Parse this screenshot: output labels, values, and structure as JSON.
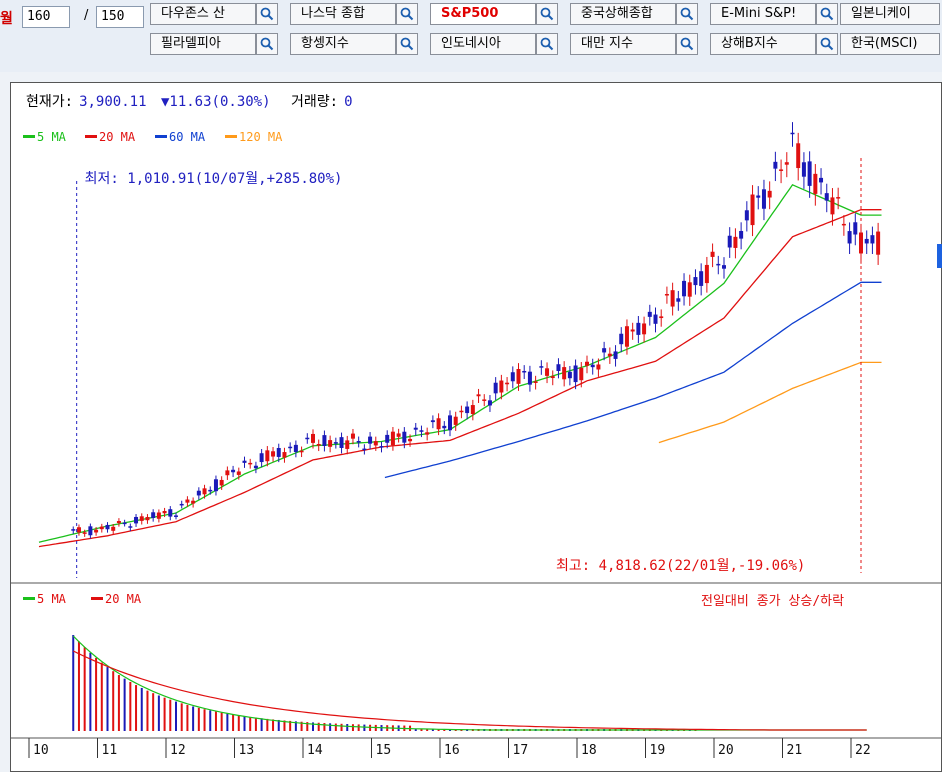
{
  "toolbar": {
    "period_label": "월",
    "count_value": "160",
    "separator": "/",
    "total_value": "150",
    "row1": [
      "다우존스 산",
      "나스닥 종합",
      "S&P500",
      "중국상해종합",
      "E-Mini S&P!",
      "일본니케이"
    ],
    "row2": [
      "필라델피아",
      "항셍지수",
      "인도네시아",
      "대만 지수",
      "상해B지수",
      "한국(MSCI)"
    ],
    "active_index": 2,
    "icon": "search-icon"
  },
  "info": {
    "price_label": "현재가:",
    "price_value": "3,900.11",
    "change_arrow": "▼",
    "change_value": "11.63(0.30%)",
    "volume_label": "거래량:",
    "volume_value": "0"
  },
  "legend_price": [
    {
      "name": "5 MA",
      "color": "#1bc01b"
    },
    {
      "name": "20 MA",
      "color": "#e01010"
    },
    {
      "name": "60 MA",
      "color": "#1040d0"
    },
    {
      "name": "120 MA",
      "color": "#ff9a1a"
    }
  ],
  "legend_volume": [
    {
      "name": "5 MA",
      "color": "#1bc01b"
    },
    {
      "name": "20 MA",
      "color": "#e01010"
    }
  ],
  "annotations": {
    "low_text": "최저: 1,010.91(10/07월,+285.80%)",
    "high_text": "최고: 4,818.62(22/01월,-19.06%)",
    "volume_note": "전일대비 종가 상승/하락"
  },
  "colors": {
    "up": "#e01010",
    "down": "#1a1ab8",
    "text_blue": "#2020c0",
    "annotation_red": "#e01010"
  },
  "chart_data": {
    "type": "line",
    "title": "S&P500",
    "x_tick_labels": [
      "10",
      "11",
      "12",
      "13",
      "14",
      "15",
      "16",
      "17",
      "18",
      "19",
      "20",
      "21",
      "22"
    ],
    "x": [
      2010,
      2011,
      2012,
      2013,
      2014,
      2015,
      2016,
      2017,
      2018,
      2019,
      2020,
      2021,
      2022
    ],
    "series": [
      {
        "name": "Close",
        "values": [
          1180,
          1260,
          1420,
          1840,
          2060,
          2045,
          2240,
          2670,
          2710,
          3230,
          3760,
          4770,
          3900
        ]
      },
      {
        "name": "5 MA",
        "values": [
          1130,
          1280,
          1400,
          1760,
          2020,
          2060,
          2170,
          2570,
          2760,
          3020,
          3520,
          4430,
          4150
        ]
      },
      {
        "name": "20 MA",
        "values": [
          1090,
          1190,
          1320,
          1590,
          1890,
          2010,
          2070,
          2320,
          2620,
          2800,
          3200,
          3950,
          4200
        ]
      },
      {
        "name": "60 MA",
        "values": [
          null,
          null,
          null,
          null,
          null,
          1720,
          1880,
          2060,
          2250,
          2460,
          2700,
          3150,
          3530
        ]
      },
      {
        "name": "120 MA",
        "values": [
          null,
          null,
          null,
          null,
          null,
          null,
          null,
          null,
          null,
          2040,
          2240,
          2550,
          2790
        ]
      }
    ],
    "low_point": {
      "value": 1010.91,
      "date": "10/07"
    },
    "high_point": {
      "value": 4818.62,
      "date": "22/01"
    },
    "volume": {
      "values": [
        0,
        0,
        0,
        0,
        0,
        0,
        0,
        0,
        0,
        0,
        0,
        0,
        0
      ]
    },
    "legend": "top-left",
    "grid": false
  }
}
